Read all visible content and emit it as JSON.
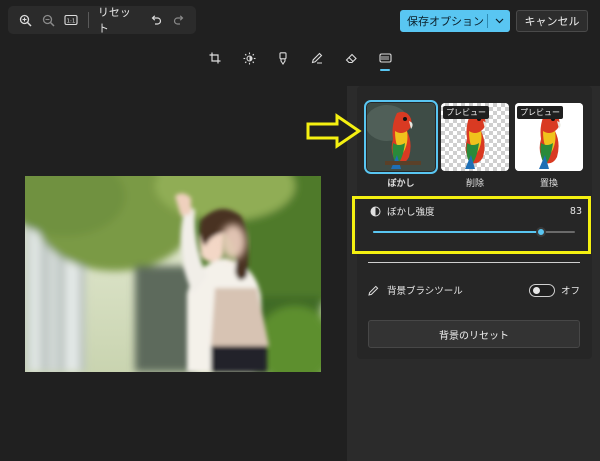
{
  "toolbar": {
    "reset_label": "リセット",
    "zoom_fit_label": "1:1"
  },
  "header": {
    "save_label": "保存オプション",
    "cancel_label": "キャンセル"
  },
  "tools": [
    {
      "name": "crop-tool-tab",
      "icon": "crop-icon"
    },
    {
      "name": "adjust-tool-tab",
      "icon": "brightness-icon"
    },
    {
      "name": "markup-tool-tab",
      "icon": "marker-icon"
    },
    {
      "name": "draw-tool-tab",
      "icon": "pen-icon"
    },
    {
      "name": "erase-tool-tab",
      "icon": "eraser-icon"
    },
    {
      "name": "background-tool-tab",
      "icon": "background-icon",
      "active": true
    }
  ],
  "background_panel": {
    "options": [
      {
        "label": "ぼかし",
        "badge": "",
        "selected": true
      },
      {
        "label": "削除",
        "badge": "プレビュー",
        "selected": false
      },
      {
        "label": "置換",
        "badge": "プレビュー",
        "selected": false
      }
    ],
    "blur": {
      "label": "ぼかし強度",
      "value": "83",
      "level": 0.83
    },
    "brush": {
      "label": "背景ブラシツール",
      "state": "オフ",
      "on": false
    },
    "reset_bg_label": "背景のリセット"
  },
  "colors": {
    "accent": "#59c6f2",
    "highlight": "#f4f011",
    "background": "#202020",
    "panel": "#2b2b2b"
  }
}
